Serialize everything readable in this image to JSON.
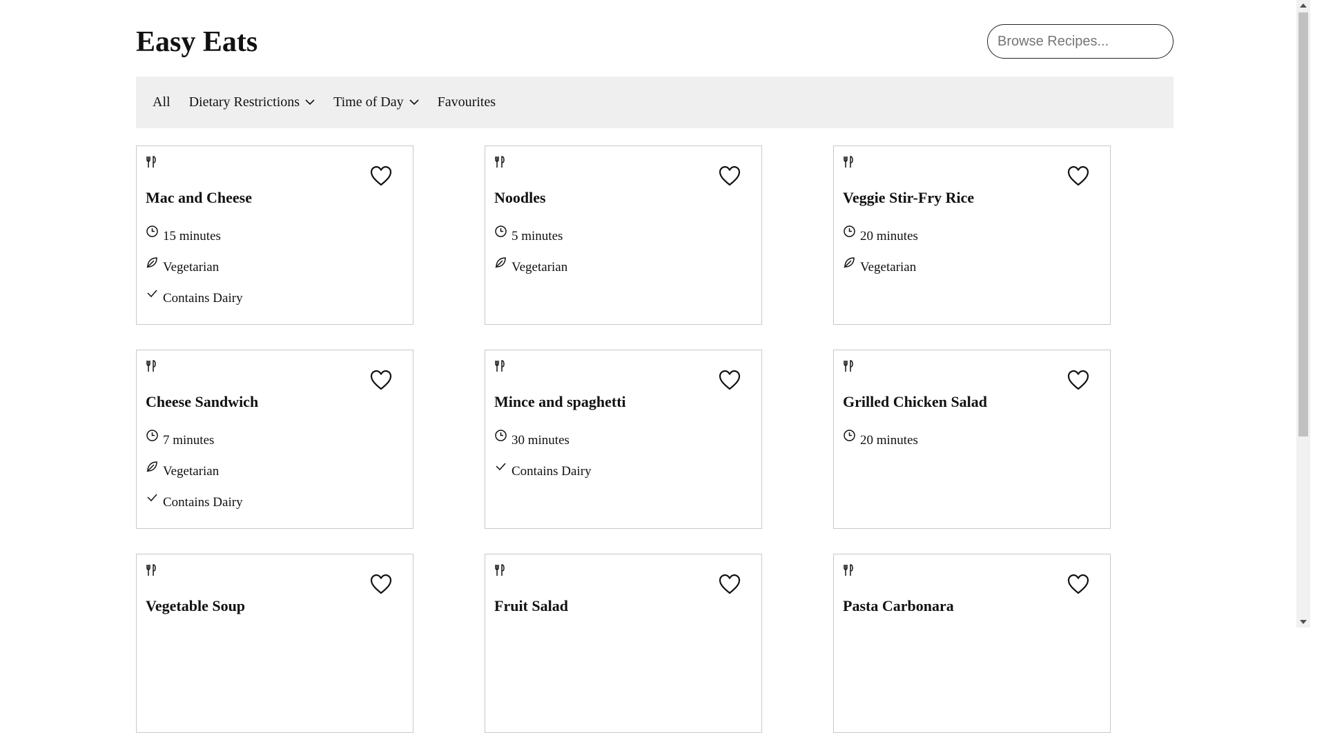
{
  "header": {
    "title": "Easy Eats",
    "search_placeholder": "Browse Recipes..."
  },
  "nav": {
    "all": "All",
    "dietary": "Dietary Restrictions",
    "time_of_day": "Time of Day",
    "favourites": "Favourites"
  },
  "recipes": [
    {
      "title": "Mac and Cheese",
      "time": "15 minutes",
      "vegetarian": "Vegetarian",
      "dairy": "Contains Dairy"
    },
    {
      "title": "Noodles",
      "time": "5 minutes",
      "vegetarian": "Vegetarian"
    },
    {
      "title": "Veggie Stir-Fry Rice",
      "time": "20 minutes",
      "vegetarian": "Vegetarian"
    },
    {
      "title": "Cheese Sandwich",
      "time": "7 minutes",
      "vegetarian": "Vegetarian",
      "dairy": "Contains Dairy"
    },
    {
      "title": "Mince and spaghetti",
      "time": "30 minutes",
      "dairy": "Contains Dairy"
    },
    {
      "title": "Grilled Chicken Salad",
      "time": "20 minutes"
    },
    {
      "title": "Vegetable Soup"
    },
    {
      "title": "Fruit Salad"
    },
    {
      "title": "Pasta Carbonara"
    }
  ],
  "icons": {
    "card_corner": "utensils-icon",
    "favourite": "heart-icon",
    "time": "clock-icon",
    "vegetarian": "leaf-icon",
    "dairy": "check-icon",
    "dropdown": "chevron-down-icon"
  }
}
